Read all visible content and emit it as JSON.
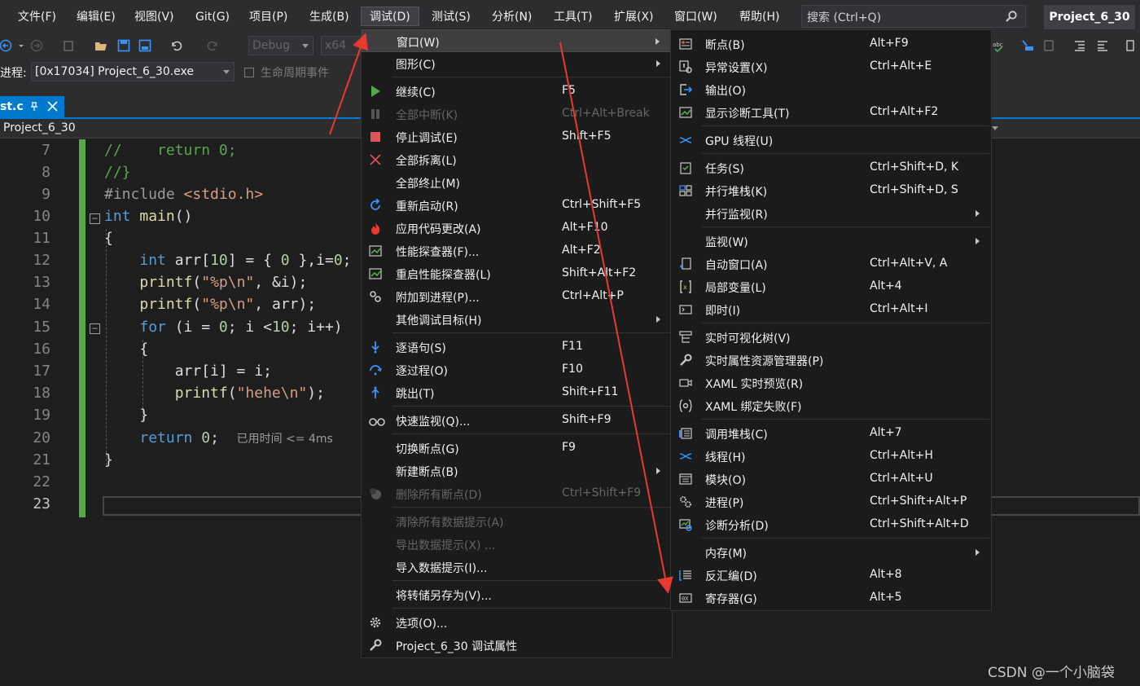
{
  "menubar": {
    "items": [
      "文件(F)",
      "编辑(E)",
      "视图(V)",
      "Git(G)",
      "项目(P)",
      "生成(B)",
      "调试(D)",
      "测试(S)",
      "分析(N)",
      "工具(T)",
      "扩展(X)",
      "窗口(W)",
      "帮助(H)"
    ],
    "search_placeholder": "搜索 (Ctrl+Q)",
    "project_name": "Project_6_30"
  },
  "toolbar": {
    "config": "Debug",
    "platform": "x64",
    "process_label": "进程:",
    "process_value": "[0x17034] Project_6_30.exe",
    "lifecycle_label": "生命周期事件"
  },
  "tab": {
    "file_name": "st.c"
  },
  "navbar": {
    "project": "Project_6_30"
  },
  "editor": {
    "line_numbers": [
      "7",
      "8",
      "9",
      "10",
      "11",
      "12",
      "13",
      "14",
      "15",
      "16",
      "17",
      "18",
      "19",
      "20",
      "21",
      "22",
      "23"
    ],
    "perf_tip": "已用时间 <= 4ms"
  },
  "debug_menu": {
    "items": [
      {
        "label": "窗口(W)",
        "shortcut": "",
        "icon": "none",
        "submenu": true,
        "highlighted": true
      },
      {
        "label": "图形(C)",
        "shortcut": "",
        "icon": "none",
        "submenu": true
      },
      {
        "label": "继续(C)",
        "shortcut": "F5",
        "icon": "play-icon"
      },
      {
        "label": "全部中断(K)",
        "shortcut": "Ctrl+Alt+Break",
        "icon": "pause-icon",
        "disabled": true
      },
      {
        "label": "停止调试(E)",
        "shortcut": "Shift+F5",
        "icon": "stop-icon"
      },
      {
        "label": "全部拆离(L)",
        "shortcut": "",
        "icon": "detach-icon"
      },
      {
        "label": "全部终止(M)",
        "shortcut": "",
        "icon": "none"
      },
      {
        "label": "重新启动(R)",
        "shortcut": "Ctrl+Shift+F5",
        "icon": "restart-icon"
      },
      {
        "label": "应用代码更改(A)",
        "shortcut": "Alt+F10",
        "icon": "hot-reload-icon"
      },
      {
        "label": "性能探查器(F)...",
        "shortcut": "Alt+F2",
        "icon": "profiler-icon"
      },
      {
        "label": "重启性能探查器(L)",
        "shortcut": "Shift+Alt+F2",
        "icon": "profiler-icon"
      },
      {
        "label": "附加到进程(P)...",
        "shortcut": "Ctrl+Alt+P",
        "icon": "attach-icon"
      },
      {
        "label": "其他调试目标(H)",
        "shortcut": "",
        "icon": "none",
        "submenu": true
      },
      {
        "label": "逐语句(S)",
        "shortcut": "F11",
        "icon": "step-into-icon"
      },
      {
        "label": "逐过程(O)",
        "shortcut": "F10",
        "icon": "step-over-icon"
      },
      {
        "label": "跳出(T)",
        "shortcut": "Shift+F11",
        "icon": "step-out-icon"
      },
      {
        "label": "快速监视(Q)...",
        "shortcut": "Shift+F9",
        "icon": "glasses-icon"
      },
      {
        "label": "切换断点(G)",
        "shortcut": "F9",
        "icon": "none"
      },
      {
        "label": "新建断点(B)",
        "shortcut": "",
        "icon": "none",
        "submenu": true
      },
      {
        "label": "删除所有断点(D)",
        "shortcut": "Ctrl+Shift+F9",
        "icon": "delete-breakpoints-icon",
        "disabled": true
      },
      {
        "label": "清除所有数据提示(A)",
        "shortcut": "",
        "icon": "none",
        "disabled": true
      },
      {
        "label": "导出数据提示(X) ...",
        "shortcut": "",
        "icon": "none",
        "disabled": true
      },
      {
        "label": "导入数据提示(I)...",
        "shortcut": "",
        "icon": "none"
      },
      {
        "label": "将转储另存为(V)...",
        "shortcut": "",
        "icon": "none"
      },
      {
        "label": "选项(O)...",
        "shortcut": "",
        "icon": "gear-icon"
      },
      {
        "label": "Project_6_30 调试属性",
        "shortcut": "",
        "icon": "wrench-icon"
      }
    ]
  },
  "window_menu": {
    "items": [
      {
        "label": "断点(B)",
        "shortcut": "Alt+F9",
        "icon": "breakpoints-window-icon"
      },
      {
        "label": "异常设置(X)",
        "shortcut": "Ctrl+Alt+E",
        "icon": "exception-icon"
      },
      {
        "label": "输出(O)",
        "shortcut": "",
        "icon": "output-icon"
      },
      {
        "label": "显示诊断工具(T)",
        "shortcut": "Ctrl+Alt+F2",
        "icon": "diagnostics-icon"
      },
      {
        "label": "GPU 线程(U)",
        "shortcut": "",
        "icon": "gpu-thread-icon"
      },
      {
        "label": "任务(S)",
        "shortcut": "Ctrl+Shift+D, K",
        "icon": "tasks-icon"
      },
      {
        "label": "并行堆栈(K)",
        "shortcut": "Ctrl+Shift+D, S",
        "icon": "parallel-stacks-icon"
      },
      {
        "label": "并行监视(R)",
        "shortcut": "",
        "icon": "none",
        "submenu": true
      },
      {
        "label": "监视(W)",
        "shortcut": "",
        "icon": "none",
        "submenu": true
      },
      {
        "label": "自动窗口(A)",
        "shortcut": "Ctrl+Alt+V, A",
        "icon": "autos-icon"
      },
      {
        "label": "局部变量(L)",
        "shortcut": "Alt+4",
        "icon": "locals-icon"
      },
      {
        "label": "即时(I)",
        "shortcut": "Ctrl+Alt+I",
        "icon": "immediate-icon"
      },
      {
        "label": "实时可视化树(V)",
        "shortcut": "",
        "icon": "visual-tree-icon"
      },
      {
        "label": "实时属性资源管理器(P)",
        "shortcut": "",
        "icon": "property-explorer-icon"
      },
      {
        "label": "XAML 实时预览(R)",
        "shortcut": "",
        "icon": "xaml-preview-icon"
      },
      {
        "label": "XAML 绑定失败(F)",
        "shortcut": "",
        "icon": "xaml-binding-icon"
      },
      {
        "label": "调用堆栈(C)",
        "shortcut": "Alt+7",
        "icon": "call-stack-icon"
      },
      {
        "label": "线程(H)",
        "shortcut": "Ctrl+Alt+H",
        "icon": "threads-icon"
      },
      {
        "label": "模块(O)",
        "shortcut": "Ctrl+Alt+U",
        "icon": "modules-icon"
      },
      {
        "label": "进程(P)",
        "shortcut": "Ctrl+Shift+Alt+P",
        "icon": "processes-icon"
      },
      {
        "label": "诊断分析(D)",
        "shortcut": "Ctrl+Shift+Alt+D",
        "icon": "diagnostic-analysis-icon"
      },
      {
        "label": "内存(M)",
        "shortcut": "",
        "icon": "none",
        "submenu": true
      },
      {
        "label": "反汇编(D)",
        "shortcut": "Alt+8",
        "icon": "disassembly-icon"
      },
      {
        "label": "寄存器(G)",
        "shortcut": "Alt+5",
        "icon": "registers-icon"
      }
    ]
  },
  "watermark": "CSDN @一个小脑袋",
  "colors": {
    "accent": "#007acc",
    "annotation_arrow": "#e8382f",
    "change_bar": "#57a64a"
  }
}
